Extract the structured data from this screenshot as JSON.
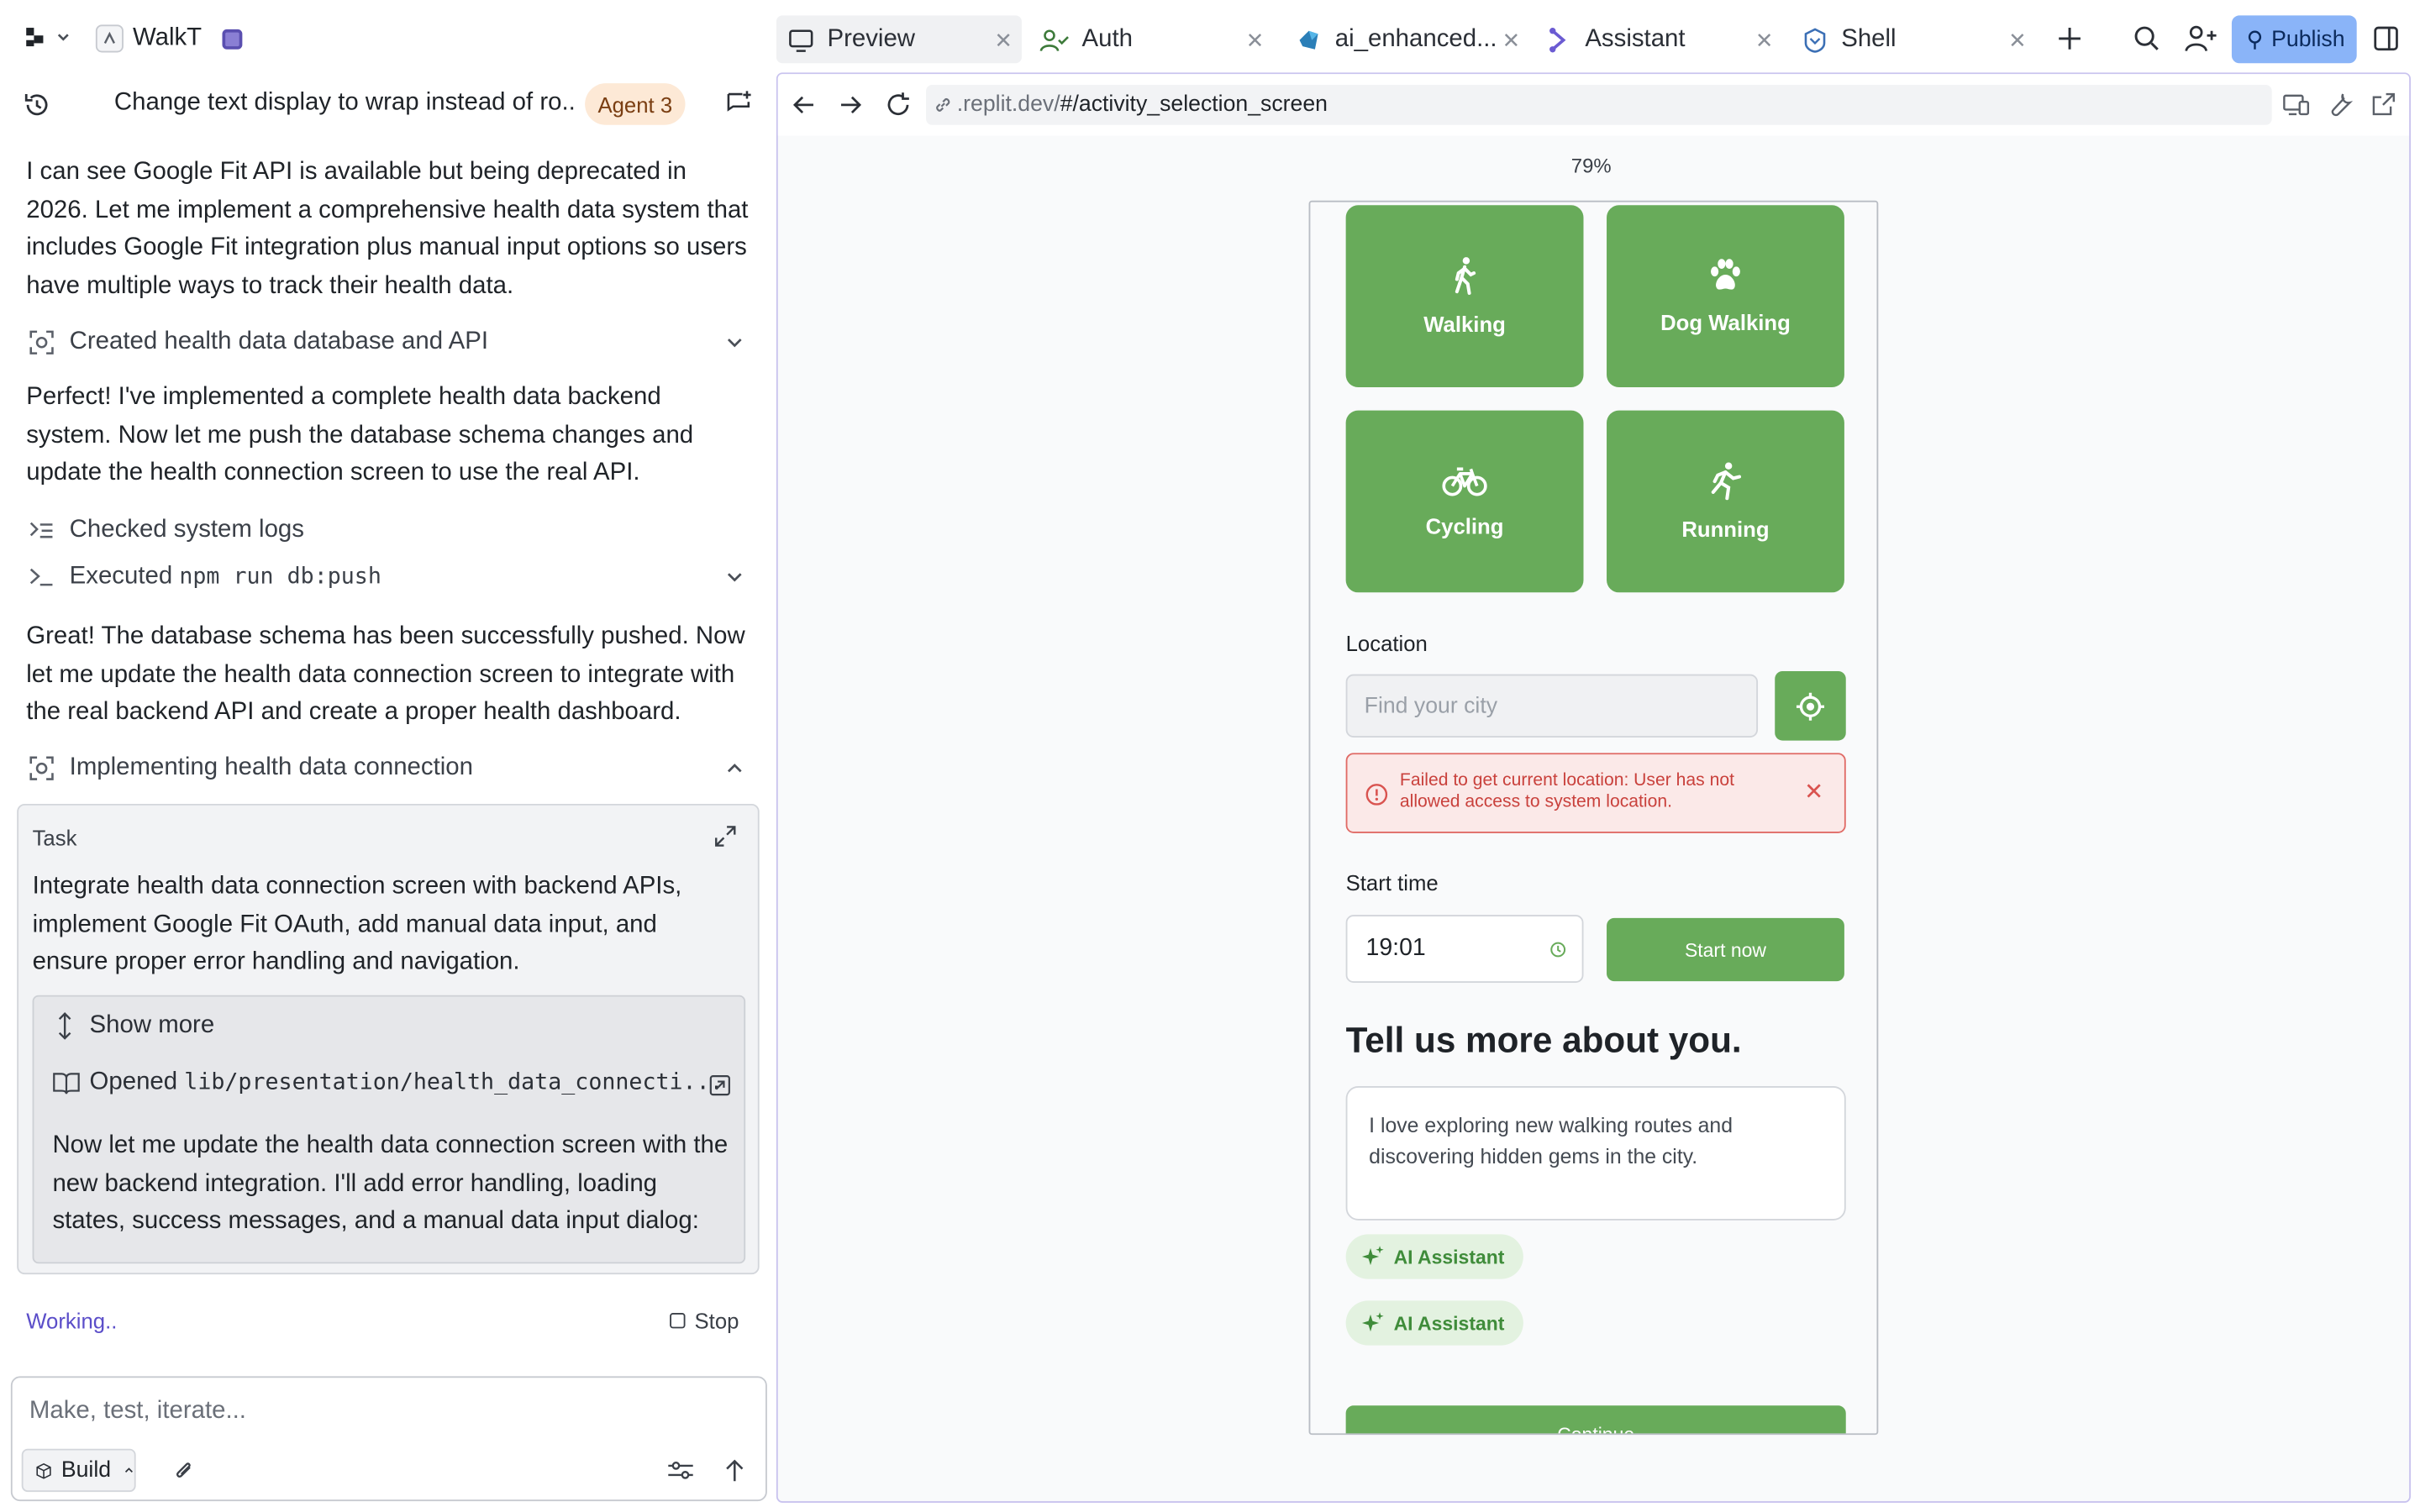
{
  "workspace": {
    "name": "WalkT"
  },
  "tabs": [
    {
      "label": "Preview",
      "icon": "monitor-icon",
      "active": true
    },
    {
      "label": "Auth",
      "icon": "user-check-icon"
    },
    {
      "label": "ai_enhanced...",
      "icon": "dart-icon"
    },
    {
      "label": "Assistant",
      "icon": "agent-icon"
    },
    {
      "label": "Shell",
      "icon": "shell-icon"
    }
  ],
  "publish_label": "Publish",
  "chat": {
    "title": "Change text display to wrap instead of ro...",
    "agent_badge": "Agent 3",
    "msg1": "I can see Google Fit API is available but being deprecated in 2026. Let me implement a comprehensive health data system that includes Google Fit integration plus manual input options so users have multiple ways to track their health data.",
    "action1": "Created health data database and API",
    "msg2": "Perfect! I've implemented a complete health data backend system. Now let me push the database schema changes and update the health connection screen to use the real API.",
    "action2": "Checked system logs",
    "action3_prefix": "Executed ",
    "action3_cmd": "npm run db:push",
    "msg3": "Great! The database schema has been successfully pushed. Now let me update the health data connection screen to integrate with the real backend API and create a proper health dashboard.",
    "action4": "Implementing health data connection",
    "task": {
      "label": "Task",
      "text": "Integrate health data connection screen with backend APIs, implement Google Fit OAuth, add manual data input, and ensure proper error handling and navigation.",
      "show_more": "Show more",
      "opened_prefix": "Opened ",
      "opened_file": "lib/presentation/health_data_connecti...",
      "body": "Now let me update the health data connection screen with the new backend integration. I'll add error handling, loading states, success messages, and a manual data input dialog:"
    },
    "status": "Working..",
    "stop_label": "Stop",
    "input_placeholder": "Make, test, iterate...",
    "mode_label": "Build"
  },
  "preview": {
    "url_host": ".replit.dev/",
    "url_path": "#/activity_selection_screen",
    "zoom": "79%"
  },
  "app": {
    "activities": [
      {
        "label": "Walking",
        "icon": "walking-icon"
      },
      {
        "label": "Dog Walking",
        "icon": "paw-icon"
      },
      {
        "label": "Cycling",
        "icon": "bicycle-icon"
      },
      {
        "label": "Running",
        "icon": "running-icon"
      }
    ],
    "location_label": "Location",
    "location_placeholder": "Find your city",
    "error_text": "Failed to get current location: User has not allowed access to system location.",
    "start_time_label": "Start time",
    "start_time_value": "19:01",
    "start_now_label": "Start now",
    "about_heading": "Tell us more about you.",
    "about_text": "I love exploring new walking routes and discovering hidden gems in the city.",
    "ai_chips": [
      "AI Assistant",
      "AI Assistant"
    ],
    "continue_label": "Continue"
  },
  "colors": {
    "accent_green": "#68ab5a",
    "publish_blue": "#8ab4f8",
    "agent_badge_bg": "#fde9d6",
    "error_red": "#d9534f"
  }
}
